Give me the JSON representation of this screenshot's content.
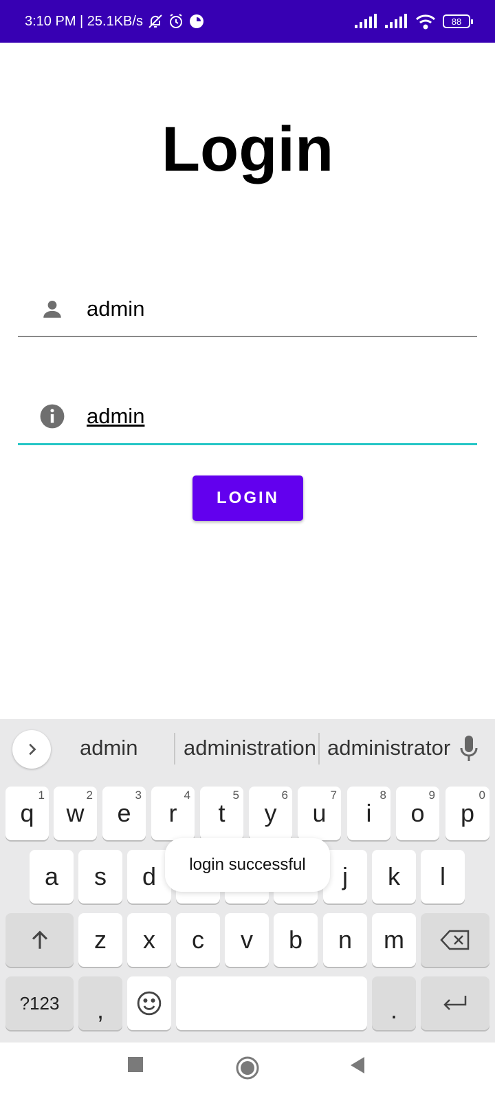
{
  "status_bar": {
    "time_speed": "3:10 PM | 25.1KB/s",
    "battery": "88",
    "icons": [
      "bell-off-icon",
      "alarm-icon",
      "data-saver-icon",
      "signal-icon",
      "signal-icon",
      "wifi-icon",
      "battery-icon"
    ]
  },
  "login": {
    "title": "Login",
    "username_value": "admin",
    "password_value": "admin",
    "button_label": "LOGIN",
    "icons": [
      "person-icon",
      "info-icon"
    ]
  },
  "colors": {
    "status_bar": "#3700b3",
    "button": "#6200ee",
    "active_underline": "#26c6c6"
  },
  "keyboard": {
    "suggestions": [
      "admin",
      "administration",
      "administrator"
    ],
    "row1": [
      {
        "key": "q",
        "hint": "1"
      },
      {
        "key": "w",
        "hint": "2"
      },
      {
        "key": "e",
        "hint": "3"
      },
      {
        "key": "r",
        "hint": "4"
      },
      {
        "key": "t",
        "hint": "5"
      },
      {
        "key": "y",
        "hint": "6"
      },
      {
        "key": "u",
        "hint": "7"
      },
      {
        "key": "i",
        "hint": "8"
      },
      {
        "key": "o",
        "hint": "9"
      },
      {
        "key": "p",
        "hint": "0"
      }
    ],
    "row2": [
      "a",
      "s",
      "d",
      "j",
      "k",
      "l"
    ],
    "row3": [
      "z",
      "x",
      "c",
      "v",
      "b",
      "n",
      "m"
    ],
    "symbols_label": "?123",
    "comma": ",",
    "period": "."
  },
  "toast": {
    "message": "login successful"
  }
}
